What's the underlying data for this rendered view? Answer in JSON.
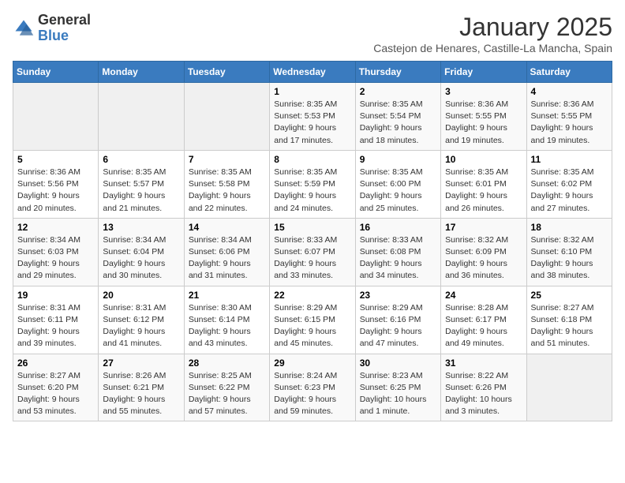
{
  "logo": {
    "general": "General",
    "blue": "Blue"
  },
  "title": "January 2025",
  "subtitle": "Castejon de Henares, Castille-La Mancha, Spain",
  "weekdays": [
    "Sunday",
    "Monday",
    "Tuesday",
    "Wednesday",
    "Thursday",
    "Friday",
    "Saturday"
  ],
  "weeks": [
    [
      {
        "day": "",
        "info": ""
      },
      {
        "day": "",
        "info": ""
      },
      {
        "day": "",
        "info": ""
      },
      {
        "day": "1",
        "info": "Sunrise: 8:35 AM\nSunset: 5:53 PM\nDaylight: 9 hours\nand 17 minutes."
      },
      {
        "day": "2",
        "info": "Sunrise: 8:35 AM\nSunset: 5:54 PM\nDaylight: 9 hours\nand 18 minutes."
      },
      {
        "day": "3",
        "info": "Sunrise: 8:36 AM\nSunset: 5:55 PM\nDaylight: 9 hours\nand 19 minutes."
      },
      {
        "day": "4",
        "info": "Sunrise: 8:36 AM\nSunset: 5:55 PM\nDaylight: 9 hours\nand 19 minutes."
      }
    ],
    [
      {
        "day": "5",
        "info": "Sunrise: 8:36 AM\nSunset: 5:56 PM\nDaylight: 9 hours\nand 20 minutes."
      },
      {
        "day": "6",
        "info": "Sunrise: 8:35 AM\nSunset: 5:57 PM\nDaylight: 9 hours\nand 21 minutes."
      },
      {
        "day": "7",
        "info": "Sunrise: 8:35 AM\nSunset: 5:58 PM\nDaylight: 9 hours\nand 22 minutes."
      },
      {
        "day": "8",
        "info": "Sunrise: 8:35 AM\nSunset: 5:59 PM\nDaylight: 9 hours\nand 24 minutes."
      },
      {
        "day": "9",
        "info": "Sunrise: 8:35 AM\nSunset: 6:00 PM\nDaylight: 9 hours\nand 25 minutes."
      },
      {
        "day": "10",
        "info": "Sunrise: 8:35 AM\nSunset: 6:01 PM\nDaylight: 9 hours\nand 26 minutes."
      },
      {
        "day": "11",
        "info": "Sunrise: 8:35 AM\nSunset: 6:02 PM\nDaylight: 9 hours\nand 27 minutes."
      }
    ],
    [
      {
        "day": "12",
        "info": "Sunrise: 8:34 AM\nSunset: 6:03 PM\nDaylight: 9 hours\nand 29 minutes."
      },
      {
        "day": "13",
        "info": "Sunrise: 8:34 AM\nSunset: 6:04 PM\nDaylight: 9 hours\nand 30 minutes."
      },
      {
        "day": "14",
        "info": "Sunrise: 8:34 AM\nSunset: 6:06 PM\nDaylight: 9 hours\nand 31 minutes."
      },
      {
        "day": "15",
        "info": "Sunrise: 8:33 AM\nSunset: 6:07 PM\nDaylight: 9 hours\nand 33 minutes."
      },
      {
        "day": "16",
        "info": "Sunrise: 8:33 AM\nSunset: 6:08 PM\nDaylight: 9 hours\nand 34 minutes."
      },
      {
        "day": "17",
        "info": "Sunrise: 8:32 AM\nSunset: 6:09 PM\nDaylight: 9 hours\nand 36 minutes."
      },
      {
        "day": "18",
        "info": "Sunrise: 8:32 AM\nSunset: 6:10 PM\nDaylight: 9 hours\nand 38 minutes."
      }
    ],
    [
      {
        "day": "19",
        "info": "Sunrise: 8:31 AM\nSunset: 6:11 PM\nDaylight: 9 hours\nand 39 minutes."
      },
      {
        "day": "20",
        "info": "Sunrise: 8:31 AM\nSunset: 6:12 PM\nDaylight: 9 hours\nand 41 minutes."
      },
      {
        "day": "21",
        "info": "Sunrise: 8:30 AM\nSunset: 6:14 PM\nDaylight: 9 hours\nand 43 minutes."
      },
      {
        "day": "22",
        "info": "Sunrise: 8:29 AM\nSunset: 6:15 PM\nDaylight: 9 hours\nand 45 minutes."
      },
      {
        "day": "23",
        "info": "Sunrise: 8:29 AM\nSunset: 6:16 PM\nDaylight: 9 hours\nand 47 minutes."
      },
      {
        "day": "24",
        "info": "Sunrise: 8:28 AM\nSunset: 6:17 PM\nDaylight: 9 hours\nand 49 minutes."
      },
      {
        "day": "25",
        "info": "Sunrise: 8:27 AM\nSunset: 6:18 PM\nDaylight: 9 hours\nand 51 minutes."
      }
    ],
    [
      {
        "day": "26",
        "info": "Sunrise: 8:27 AM\nSunset: 6:20 PM\nDaylight: 9 hours\nand 53 minutes."
      },
      {
        "day": "27",
        "info": "Sunrise: 8:26 AM\nSunset: 6:21 PM\nDaylight: 9 hours\nand 55 minutes."
      },
      {
        "day": "28",
        "info": "Sunrise: 8:25 AM\nSunset: 6:22 PM\nDaylight: 9 hours\nand 57 minutes."
      },
      {
        "day": "29",
        "info": "Sunrise: 8:24 AM\nSunset: 6:23 PM\nDaylight: 9 hours\nand 59 minutes."
      },
      {
        "day": "30",
        "info": "Sunrise: 8:23 AM\nSunset: 6:25 PM\nDaylight: 10 hours\nand 1 minute."
      },
      {
        "day": "31",
        "info": "Sunrise: 8:22 AM\nSunset: 6:26 PM\nDaylight: 10 hours\nand 3 minutes."
      },
      {
        "day": "",
        "info": ""
      }
    ]
  ]
}
